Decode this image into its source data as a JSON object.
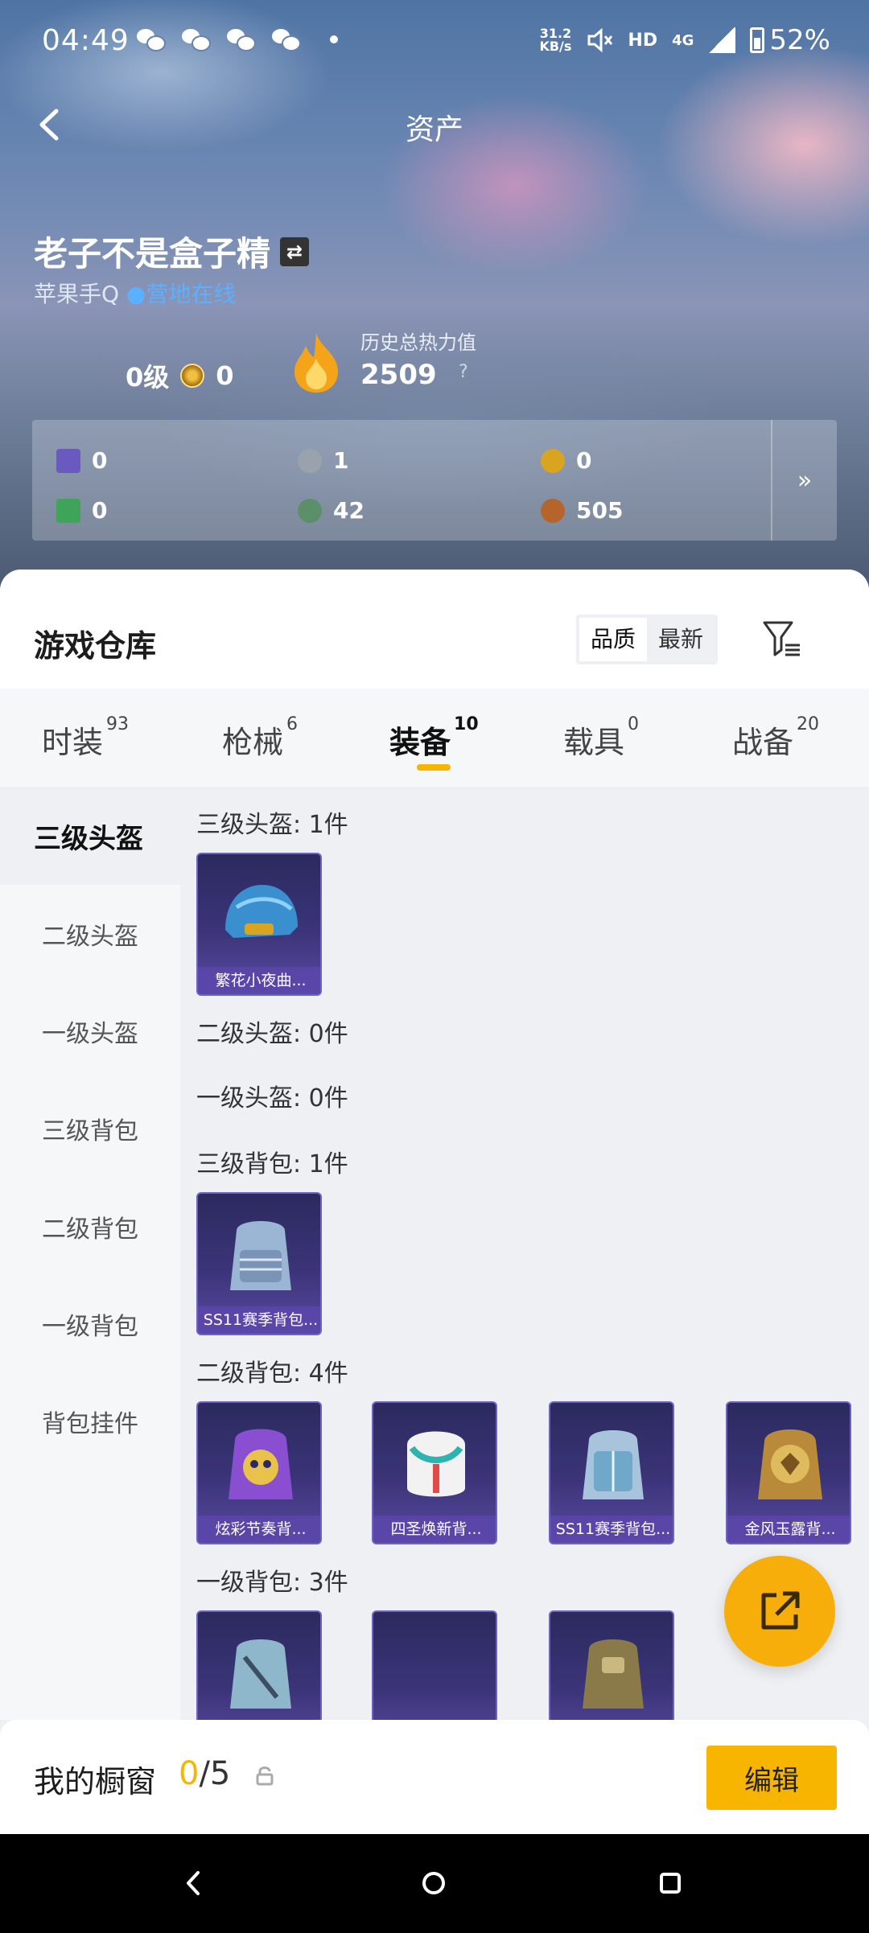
{
  "status_bar": {
    "time": "04:49",
    "net_speed_value": "31.2",
    "net_speed_unit": "KB/s",
    "network": "4G",
    "battery": "52%"
  },
  "header": {
    "title": "资产"
  },
  "profile": {
    "name": "老子不是盒子精",
    "platform": "苹果手Q",
    "status": "营地在线",
    "level": "0级",
    "rank_value": "0",
    "heat_label": "历史总热力值",
    "heat_value": "2509"
  },
  "currencies": [
    {
      "icon": "purple-card-icon",
      "value": "0",
      "color": "#6a5ac0"
    },
    {
      "icon": "silver-coin-icon",
      "value": "1",
      "color": "#9aa2ad"
    },
    {
      "icon": "gold-coin-icon",
      "value": "0",
      "color": "#d9a520"
    },
    {
      "icon": "green-card-icon",
      "value": "0",
      "color": "#3fa35a"
    },
    {
      "icon": "green-gem-icon",
      "value": "42",
      "color": "#5a8f6a"
    },
    {
      "icon": "bronze-coin-icon",
      "value": "505",
      "color": "#b5652c"
    }
  ],
  "warehouse": {
    "title": "游戏仓库",
    "sort_quality": "品质",
    "sort_latest": "最新"
  },
  "tabs": [
    {
      "label": "时装",
      "count": "93"
    },
    {
      "label": "枪械",
      "count": "6"
    },
    {
      "label": "装备",
      "count": "10"
    },
    {
      "label": "载具",
      "count": "0"
    },
    {
      "label": "战备",
      "count": "20"
    }
  ],
  "sidebar": [
    {
      "label": "三级头盔"
    },
    {
      "label": "二级头盔"
    },
    {
      "label": "一级头盔"
    },
    {
      "label": "三级背包"
    },
    {
      "label": "二级背包"
    },
    {
      "label": "一级背包"
    },
    {
      "label": "背包挂件"
    }
  ],
  "sections": [
    {
      "label": "三级头盔: 1件",
      "items": [
        "繁花小夜曲..."
      ]
    },
    {
      "label": "二级头盔: 0件",
      "items": []
    },
    {
      "label": "一级头盔: 0件",
      "items": []
    },
    {
      "label": "三级背包: 1件",
      "items": [
        "SS11赛季背包..."
      ]
    },
    {
      "label": "二级背包: 4件",
      "items": [
        "炫彩节奏背...",
        "四圣焕新背...",
        "SS11赛季背包...",
        "金风玉露背..."
      ]
    },
    {
      "label": "一级背包: 3件",
      "items": []
    }
  ],
  "showcase": {
    "label": "我的橱窗",
    "current": "0",
    "total": "/5",
    "edit_label": "编辑"
  }
}
